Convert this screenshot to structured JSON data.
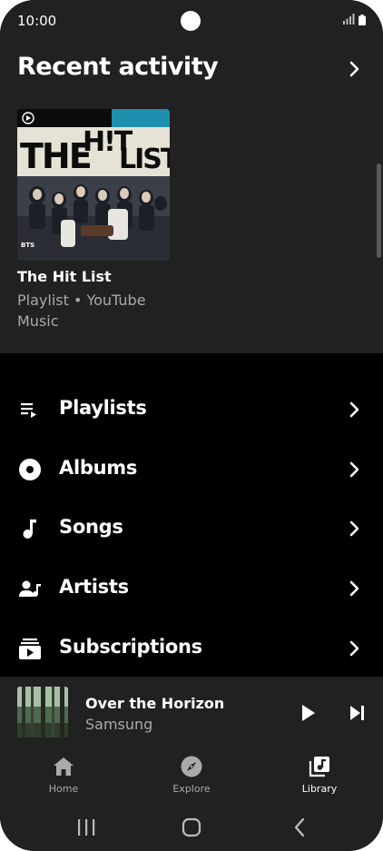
{
  "status_bar": {
    "time": "10:00"
  },
  "recent": {
    "title": "Recent activity",
    "card": {
      "title": "The Hit List",
      "subtitle": "Playlist • YouTube Music",
      "art_heading_left": "THE",
      "art_heading_mid": "H!T",
      "art_heading_right": "LIST",
      "art_badge": "BTS"
    }
  },
  "menu": {
    "items": [
      {
        "label": "Playlists",
        "icon": "playlist-icon"
      },
      {
        "label": "Albums",
        "icon": "album-icon"
      },
      {
        "label": "Songs",
        "icon": "music-note-icon"
      },
      {
        "label": "Artists",
        "icon": "artist-icon"
      },
      {
        "label": "Subscriptions",
        "icon": "subscriptions-icon"
      }
    ]
  },
  "now_playing": {
    "title": "Over the Horizon",
    "artist": "Samsung"
  },
  "bottom_nav": {
    "items": [
      {
        "label": "Home",
        "icon": "home-icon",
        "active": false
      },
      {
        "label": "Explore",
        "icon": "compass-icon",
        "active": false
      },
      {
        "label": "Library",
        "icon": "library-icon",
        "active": true
      }
    ]
  },
  "colors": {
    "surface": "#212121",
    "background": "#000000",
    "text_primary": "#ffffff",
    "text_secondary": "#aaaaaa"
  }
}
